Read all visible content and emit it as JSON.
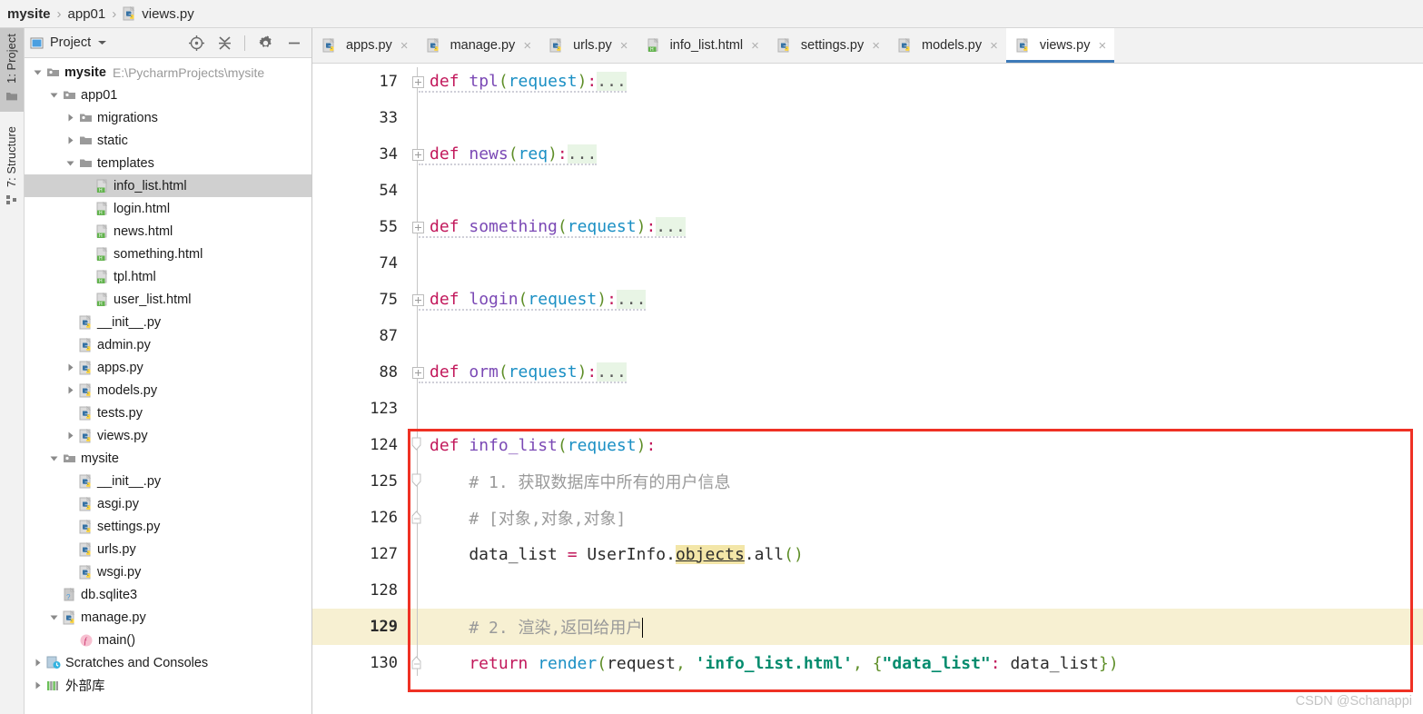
{
  "breadcrumb": {
    "items": [
      {
        "label": "mysite",
        "bold": true,
        "icon": null
      },
      {
        "label": "app01",
        "bold": false,
        "icon": null
      },
      {
        "label": "views.py",
        "bold": false,
        "icon": "python-file-icon"
      }
    ],
    "separator": "›"
  },
  "rail": {
    "buttons": [
      {
        "label": "1: Project",
        "icon": "project-folder-icon",
        "active": true
      },
      {
        "label": "7: Structure",
        "icon": "structure-icon",
        "active": false
      }
    ]
  },
  "project_panel": {
    "title": "Project",
    "dropdown_icon": "chevron-down-icon",
    "tools": [
      {
        "name": "locate-icon",
        "title": "Select Opened File"
      },
      {
        "name": "collapse-all-icon",
        "title": "Collapse All"
      },
      {
        "name": "gear-icon",
        "title": "Settings"
      },
      {
        "name": "minimize-icon",
        "title": "Hide"
      }
    ],
    "tree": [
      {
        "label": "mysite",
        "path": "E:\\PycharmProjects\\mysite",
        "indent": 0,
        "arrow": "down",
        "icon": "folder-module-icon",
        "bold": true,
        "selected": false
      },
      {
        "label": "app01",
        "path": "",
        "indent": 1,
        "arrow": "down",
        "icon": "folder-module-icon",
        "bold": false,
        "selected": false
      },
      {
        "label": "migrations",
        "path": "",
        "indent": 2,
        "arrow": "right",
        "icon": "folder-module-icon",
        "bold": false,
        "selected": false
      },
      {
        "label": "static",
        "path": "",
        "indent": 2,
        "arrow": "right",
        "icon": "folder-icon",
        "bold": false,
        "selected": false
      },
      {
        "label": "templates",
        "path": "",
        "indent": 2,
        "arrow": "down",
        "icon": "folder-icon",
        "bold": false,
        "selected": false
      },
      {
        "label": "info_list.html",
        "path": "",
        "indent": 3,
        "arrow": "none",
        "icon": "html-file-icon",
        "bold": false,
        "selected": true
      },
      {
        "label": "login.html",
        "path": "",
        "indent": 3,
        "arrow": "none",
        "icon": "html-file-icon",
        "bold": false,
        "selected": false
      },
      {
        "label": "news.html",
        "path": "",
        "indent": 3,
        "arrow": "none",
        "icon": "html-file-icon",
        "bold": false,
        "selected": false
      },
      {
        "label": "something.html",
        "path": "",
        "indent": 3,
        "arrow": "none",
        "icon": "html-file-icon",
        "bold": false,
        "selected": false
      },
      {
        "label": "tpl.html",
        "path": "",
        "indent": 3,
        "arrow": "none",
        "icon": "html-file-icon",
        "bold": false,
        "selected": false
      },
      {
        "label": "user_list.html",
        "path": "",
        "indent": 3,
        "arrow": "none",
        "icon": "html-file-icon",
        "bold": false,
        "selected": false
      },
      {
        "label": "__init__.py",
        "path": "",
        "indent": 2,
        "arrow": "none",
        "icon": "python-file-icon",
        "bold": false,
        "selected": false
      },
      {
        "label": "admin.py",
        "path": "",
        "indent": 2,
        "arrow": "none",
        "icon": "python-file-icon",
        "bold": false,
        "selected": false
      },
      {
        "label": "apps.py",
        "path": "",
        "indent": 2,
        "arrow": "right",
        "icon": "python-file-icon",
        "bold": false,
        "selected": false
      },
      {
        "label": "models.py",
        "path": "",
        "indent": 2,
        "arrow": "right",
        "icon": "python-file-icon",
        "bold": false,
        "selected": false
      },
      {
        "label": "tests.py",
        "path": "",
        "indent": 2,
        "arrow": "none",
        "icon": "python-file-icon",
        "bold": false,
        "selected": false
      },
      {
        "label": "views.py",
        "path": "",
        "indent": 2,
        "arrow": "right",
        "icon": "python-file-icon",
        "bold": false,
        "selected": false
      },
      {
        "label": "mysite",
        "path": "",
        "indent": 1,
        "arrow": "down",
        "icon": "folder-module-icon",
        "bold": false,
        "selected": false
      },
      {
        "label": "__init__.py",
        "path": "",
        "indent": 2,
        "arrow": "none",
        "icon": "python-file-icon",
        "bold": false,
        "selected": false
      },
      {
        "label": "asgi.py",
        "path": "",
        "indent": 2,
        "arrow": "none",
        "icon": "python-file-icon",
        "bold": false,
        "selected": false
      },
      {
        "label": "settings.py",
        "path": "",
        "indent": 2,
        "arrow": "none",
        "icon": "python-file-icon",
        "bold": false,
        "selected": false
      },
      {
        "label": "urls.py",
        "path": "",
        "indent": 2,
        "arrow": "none",
        "icon": "python-file-icon",
        "bold": false,
        "selected": false
      },
      {
        "label": "wsgi.py",
        "path": "",
        "indent": 2,
        "arrow": "none",
        "icon": "python-file-icon",
        "bold": false,
        "selected": false
      },
      {
        "label": "db.sqlite3",
        "path": "",
        "indent": 1,
        "arrow": "none",
        "icon": "unknown-file-icon",
        "bold": false,
        "selected": false
      },
      {
        "label": "manage.py",
        "path": "",
        "indent": 1,
        "arrow": "down",
        "icon": "python-file-icon",
        "bold": false,
        "selected": false
      },
      {
        "label": "main()",
        "path": "",
        "indent": 2,
        "arrow": "none",
        "icon": "function-icon",
        "bold": false,
        "selected": false
      },
      {
        "label": "Scratches and Consoles",
        "path": "",
        "indent": 0,
        "arrow": "right",
        "icon": "scratches-icon",
        "bold": false,
        "selected": false
      },
      {
        "label": "外部库",
        "path": "",
        "indent": 0,
        "arrow": "right",
        "icon": "external-libraries-icon",
        "bold": false,
        "selected": false
      }
    ]
  },
  "editor": {
    "tabs": [
      {
        "label": "apps.py",
        "icon": "python-file-icon",
        "active": false,
        "close": "×"
      },
      {
        "label": "manage.py",
        "icon": "python-file-icon",
        "active": false,
        "close": "×"
      },
      {
        "label": "urls.py",
        "icon": "python-file-icon",
        "active": false,
        "close": "×"
      },
      {
        "label": "info_list.html",
        "icon": "html-file-icon",
        "active": false,
        "close": "×"
      },
      {
        "label": "settings.py",
        "icon": "python-file-icon",
        "active": false,
        "close": "×"
      },
      {
        "label": "models.py",
        "icon": "python-file-icon",
        "active": false,
        "close": "×"
      },
      {
        "label": "views.py",
        "icon": "python-file-icon",
        "active": true,
        "close": "×"
      }
    ],
    "line_numbers": [
      "17",
      "33",
      "34",
      "54",
      "55",
      "74",
      "75",
      "87",
      "88",
      "123",
      "124",
      "125",
      "126",
      "127",
      "128",
      "129",
      "130"
    ],
    "current_line": "129",
    "lines": [
      {
        "num": "17",
        "type": "fold",
        "fold": "plus",
        "tokens": [
          {
            "t": "def ",
            "c": "kw"
          },
          {
            "t": "tpl",
            "c": "fn"
          },
          {
            "t": "(",
            "c": "paren"
          },
          {
            "t": "request",
            "c": "prm"
          },
          {
            "t": ")",
            "c": "paren"
          },
          {
            "t": ":",
            "c": "op"
          },
          {
            "t": "...",
            "c": "fold"
          }
        ]
      },
      {
        "num": "33",
        "type": "blank",
        "fold": "none",
        "tokens": []
      },
      {
        "num": "34",
        "type": "fold",
        "fold": "plus",
        "tokens": [
          {
            "t": "def ",
            "c": "kw"
          },
          {
            "t": "news",
            "c": "fn"
          },
          {
            "t": "(",
            "c": "paren"
          },
          {
            "t": "req",
            "c": "prm"
          },
          {
            "t": ")",
            "c": "paren"
          },
          {
            "t": ":",
            "c": "op"
          },
          {
            "t": "...",
            "c": "fold"
          }
        ]
      },
      {
        "num": "54",
        "type": "blank",
        "fold": "none",
        "tokens": []
      },
      {
        "num": "55",
        "type": "fold",
        "fold": "plus",
        "tokens": [
          {
            "t": "def ",
            "c": "kw"
          },
          {
            "t": "something",
            "c": "fn"
          },
          {
            "t": "(",
            "c": "paren"
          },
          {
            "t": "request",
            "c": "prm"
          },
          {
            "t": ")",
            "c": "paren"
          },
          {
            "t": ":",
            "c": "op"
          },
          {
            "t": "...",
            "c": "fold"
          }
        ]
      },
      {
        "num": "74",
        "type": "blank",
        "fold": "none",
        "tokens": []
      },
      {
        "num": "75",
        "type": "fold",
        "fold": "plus",
        "tokens": [
          {
            "t": "def ",
            "c": "kw"
          },
          {
            "t": "login",
            "c": "fn"
          },
          {
            "t": "(",
            "c": "paren"
          },
          {
            "t": "request",
            "c": "prm"
          },
          {
            "t": ")",
            "c": "paren"
          },
          {
            "t": ":",
            "c": "op"
          },
          {
            "t": "...",
            "c": "fold"
          }
        ]
      },
      {
        "num": "87",
        "type": "blank",
        "fold": "none",
        "tokens": []
      },
      {
        "num": "88",
        "type": "fold",
        "fold": "plus",
        "tokens": [
          {
            "t": "def ",
            "c": "kw"
          },
          {
            "t": "orm",
            "c": "fn"
          },
          {
            "t": "(",
            "c": "paren"
          },
          {
            "t": "request",
            "c": "prm"
          },
          {
            "t": ")",
            "c": "paren"
          },
          {
            "t": ":",
            "c": "op"
          },
          {
            "t": "...",
            "c": "fold"
          }
        ]
      },
      {
        "num": "123",
        "type": "blank",
        "fold": "none",
        "tokens": []
      },
      {
        "num": "124",
        "type": "code",
        "fold": "open-top",
        "tokens": [
          {
            "t": "def ",
            "c": "kw"
          },
          {
            "t": "info_list",
            "c": "fn"
          },
          {
            "t": "(",
            "c": "paren"
          },
          {
            "t": "request",
            "c": "prm"
          },
          {
            "t": ")",
            "c": "paren"
          },
          {
            "t": ":",
            "c": "op"
          }
        ]
      },
      {
        "num": "125",
        "type": "code",
        "fold": "open-mid",
        "tokens": [
          {
            "t": "    # 1. 获取数据库中所有的用户信息",
            "c": "cmt"
          }
        ]
      },
      {
        "num": "126",
        "type": "code",
        "fold": "open-end",
        "tokens": [
          {
            "t": "    # [对象,对象,对象]",
            "c": "cmt"
          }
        ]
      },
      {
        "num": "127",
        "type": "code",
        "fold": "none",
        "tokens": [
          {
            "t": "    data_list ",
            "c": "id"
          },
          {
            "t": "=",
            "c": "op"
          },
          {
            "t": " UserInfo.",
            "c": "id"
          },
          {
            "t": "objects",
            "c": "hl"
          },
          {
            "t": ".all",
            "c": "id"
          },
          {
            "t": "()",
            "c": "paren"
          }
        ]
      },
      {
        "num": "128",
        "type": "blank",
        "fold": "none",
        "tokens": []
      },
      {
        "num": "129",
        "type": "code",
        "fold": "none",
        "current": true,
        "tokens": [
          {
            "t": "    # 2. 渲染,返回给用户",
            "c": "cmt"
          },
          {
            "t": "|",
            "c": "caret"
          }
        ]
      },
      {
        "num": "130",
        "type": "code",
        "fold": "open-end",
        "tokens": [
          {
            "t": "    return",
            "c": "kw"
          },
          {
            "t": " render",
            "c": "prm"
          },
          {
            "t": "(",
            "c": "paren"
          },
          {
            "t": "request",
            "c": "id"
          },
          {
            "t": ",",
            "c": "paren"
          },
          {
            "t": " ",
            "c": "id"
          },
          {
            "t": "'info_list.html'",
            "c": "str"
          },
          {
            "t": ",",
            "c": "paren"
          },
          {
            "t": " ",
            "c": "id"
          },
          {
            "t": "{",
            "c": "paren"
          },
          {
            "t": "\"data_list\"",
            "c": "str"
          },
          {
            "t": ":",
            "c": "op"
          },
          {
            "t": " data_list",
            "c": "id"
          },
          {
            "t": "}",
            "c": "paren"
          },
          {
            "t": ")",
            "c": "paren"
          }
        ]
      }
    ],
    "annotation": {
      "name": "red-highlight-rectangle",
      "color": "#ef3124"
    },
    "watermark": "CSDN @Schanappi"
  },
  "colors": {
    "accent": "#3d7ab8",
    "annotation": "#ef3124",
    "current_line_bg": "#f7f0d2",
    "selection_bg": "#d0d0d0",
    "fold_bg": "#e8f5e5",
    "identifier_highlight": "#f3e6a8",
    "keyword": "#c2185b",
    "function": "#7b49b5",
    "parameter": "#1a8fc4",
    "string": "#038c6e",
    "comment": "#9a9a9a"
  }
}
